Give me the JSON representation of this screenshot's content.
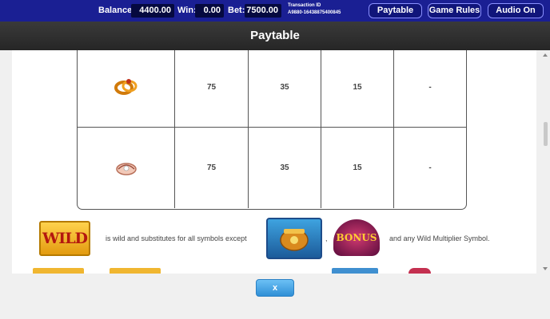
{
  "topbar": {
    "balance_label": "Balance:",
    "balance_value": "4400.00",
    "win_label": "Win:",
    "win_value": "0.00",
    "bet_label": "Bet:",
    "bet_value": "7500.00",
    "transaction_label": "Transaction ID",
    "transaction_id": "A9880-16438875400845",
    "paytable_button": "Paytable",
    "game_rules_button": "Game Rules",
    "audio_button": "Audio On"
  },
  "header": {
    "title": "Paytable"
  },
  "paytable": {
    "rows": [
      {
        "symbol_icon": "gold-ring-icon",
        "values": [
          "75",
          "35",
          "15",
          "-"
        ]
      },
      {
        "symbol_icon": "seashell-icon",
        "values": [
          "75",
          "35",
          "15",
          "-"
        ]
      }
    ]
  },
  "wild_info": {
    "wild_symbol_text": "WILD",
    "text_before": "is wild and substitutes for all symbols except",
    "separator": ",",
    "bonus_symbol_text": "BONUS",
    "text_after": "and any Wild Multiplier Symbol.",
    "excluded_symbol_icon": "treasure-pot-icon"
  },
  "footer": {
    "close_label": "x"
  },
  "colors": {
    "topbar_bg": "#1a1f93",
    "header_bg": "#2e2e2e",
    "close_button": "#3b9be0"
  }
}
